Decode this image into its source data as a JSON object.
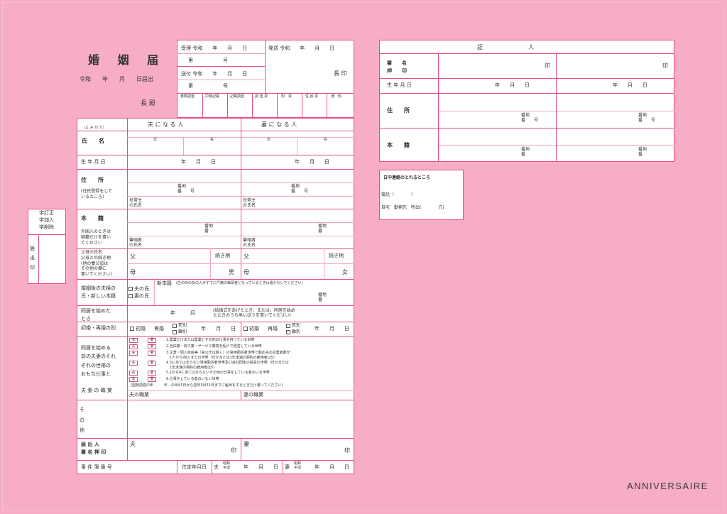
{
  "header": {
    "title": "婚 姻 届",
    "date_line": "令和　　年　　月　　日届出",
    "addressee": "長 殿"
  },
  "office": {
    "accept": "受理 令和　　年　　月　　日",
    "accept_no": "第　　　　　　号",
    "send": "発送 令和　　年　　月　　日",
    "forward": "送付 令和　　年　　月　　日",
    "forward_no": "第　　　　　　号",
    "chief_seal": "長 印",
    "checks": [
      "書類調査",
      "戸籍記載",
      "記載調査",
      "調 査 票",
      "附　票",
      "住 民 票",
      "通　知"
    ]
  },
  "side": {
    "correction": [
      "字訂正",
      "字加入",
      "字削除"
    ],
    "seal": "届\n出\n印"
  },
  "form": {
    "furigana": "（よ み か た）",
    "husband_head": "夫 に な る 人",
    "wife_head": "妻 に な る 人",
    "name_label": "氏　　名",
    "surname": "氏",
    "given": "名",
    "birth_label": "生 年 月 日",
    "ymd": "年　　月　　日",
    "address_label": "住　　所",
    "address_note": "(住民登録をして\nいるところ)",
    "banchi": "番地\n番　　号",
    "householder": "世帯主\nの氏名",
    "honseki_label": "本　　籍",
    "honseki_note": "外国人のときは\n国籍だけを書い\nてください",
    "banchi2": "番地\n番",
    "hittosha": "筆頭者\nの氏名",
    "parents_label": "父母の氏名\n父母との続き柄\n(他の養父母は\nその他の欄に\n書いてください)",
    "zokugara": "続き柄",
    "father": "父",
    "mother": "母",
    "son": "男",
    "daughter": "女",
    "after_label": "婚姻後の夫婦の\n氏・新しい本籍",
    "husband_surname": "夫の氏",
    "wife_surname": "妻の氏",
    "new_honseki": "新本籍",
    "new_honseki_note": "(左の㈪の氏の人がすでに戸籍の筆頭者となっているときは書かないでください)",
    "cohabit_label": "同居を始めた\nとき",
    "cohabit_ym": "年　　　月",
    "cohabit_note": "(結婚式をあげたとき、または、同居を始め\nたときのうち早いほうを書いてください)",
    "first_label": "初婚・再婚の別",
    "first": "初婚",
    "re": "再婚",
    "shibetsu": "死別",
    "ribetsu": "離別",
    "ymd_short": "年　　月　　日",
    "work_label": "同居を始める\n前の夫妻のそれ\nぞれの世帯の\nおもな仕事と",
    "husband_tag": "夫",
    "wife_tag": "妻",
    "work_items": [
      "1.農業だけまたは農業とその他の仕事を持っている世帯",
      "2.自由業・商工業・サービス業等を個人で経営している世帯",
      "3.企業・個人商店等（官公庁は除く）の常用勤労者世帯で勤め先の従業者数が",
      "　1人から99人までの世帯（日々または1年未満の契約の雇用者は5）",
      "4.3にあてはまらない常用勤労者世帯及び会社団体の役員の世帯（日々または",
      "　1年未満の契約の雇用者は5）",
      "5.1から4にあてはまらないその他の仕事をしている者のいる世帯",
      "6.仕事をしている者のいない世帯"
    ],
    "census": "(国勢調査の年…　　年…の4月1日から翌年3月31日までに届出をするときだけ書いてください)",
    "job_label": "夫 妻 の 職 業",
    "husband_job": "夫の職業",
    "wife_job": "妻の職業",
    "other_label": "そ\nの\n他",
    "sign_label": "届 出 人\n署 名 押 印",
    "sign_h": "夫",
    "sign_w": "妻",
    "seal": "印",
    "case_label": "事 件 簿 番 号",
    "planned": "住定年月日",
    "planned_h": "夫",
    "planned_w": "妻",
    "reiwa": "昭和\n平成",
    "ymd_plan": "年　　月　　日"
  },
  "witness": {
    "title": "証　　　　　　　　人",
    "sign": "署　　名\n押　　印",
    "seal": "印",
    "birth": "生 年 月 日",
    "ymd": "年　　月　　日",
    "address": "住　　所",
    "banchi": "番地\n番　　号",
    "honseki": "本　　籍",
    "banchi2": "番地\n番"
  },
  "contact": {
    "title": "日中連絡のとれるところ",
    "phone": "電話（　　　　）",
    "where": "自宅　勤務先　呼出(　　　　方)"
  },
  "brand": "ANNIVERSAIRE"
}
